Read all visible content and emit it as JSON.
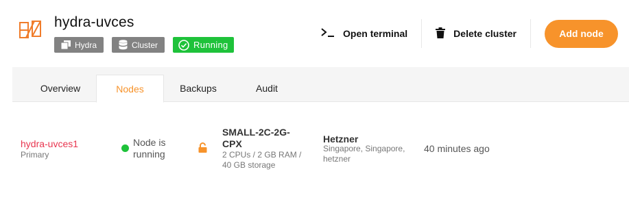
{
  "cluster": {
    "name": "hydra-uvces",
    "badges": {
      "type": "Hydra",
      "kind": "Cluster",
      "status": "Running"
    }
  },
  "actions": {
    "open_terminal": "Open terminal",
    "delete_cluster": "Delete cluster",
    "add_node": "Add node"
  },
  "tabs": [
    {
      "label": "Overview",
      "active": false
    },
    {
      "label": "Nodes",
      "active": true
    },
    {
      "label": "Backups",
      "active": false
    },
    {
      "label": "Audit",
      "active": false
    }
  ],
  "nodes": [
    {
      "name": "hydra-uvces1",
      "role": "Primary",
      "status": "Node is running",
      "plan": "SMALL-2C-2G-CPX",
      "plan_details": "2 CPUs / 2 GB RAM / 40 GB storage",
      "provider": "Hetzner",
      "location": "Singapore, Singapore, hetzner",
      "created": "40 minutes ago"
    }
  ],
  "colors": {
    "accent": "#f7932b",
    "running": "#1ec23a",
    "node_link": "#e8344e",
    "badge_grey": "#828282"
  }
}
